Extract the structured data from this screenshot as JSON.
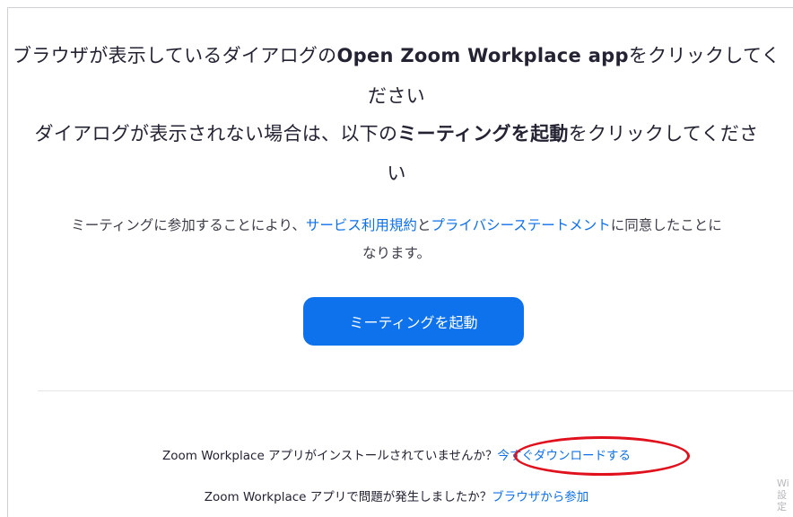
{
  "instructions": {
    "line1_pre": "ブラウザが表示しているダイアログの",
    "line1_bold": "Open Zoom Workplace app",
    "line1_post": "をクリックしてく",
    "line1_wrap": "ださい",
    "line2_pre": "ダイアログが表示されない場合は、以下の",
    "line2_bold": "ミーティングを起動",
    "line2_post": "をクリックしてくださ",
    "line2_wrap": "い"
  },
  "terms": {
    "pre": "ミーティングに参加することにより、",
    "tos_link": "サービス利用規約",
    "mid": "と",
    "privacy_link": "プライバシーステートメント",
    "post": "に同意したことに",
    "wrap": "なります。"
  },
  "launch_button": {
    "label": "ミーティングを起動"
  },
  "footer": {
    "not_installed_text": "Zoom Workplace アプリがインストールされていませんか？",
    "download_link": "今すぐダウンロードする",
    "problem_text": "Zoom Workplace アプリで問題が発生しましたか？",
    "browser_link": "ブラウザから参加"
  },
  "watermark": {
    "line1": "Wi",
    "line2": "設定"
  },
  "colors": {
    "accent": "#0e72ed",
    "link": "#0e71eb",
    "highlight_circle": "#e0101c"
  }
}
